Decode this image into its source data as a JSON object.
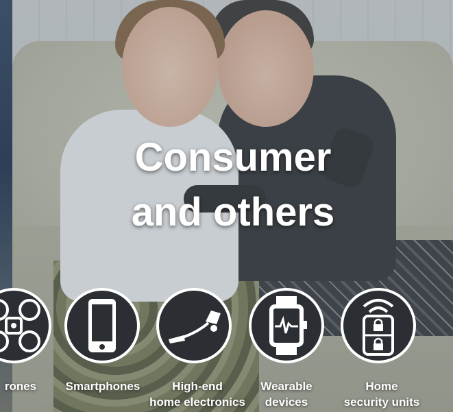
{
  "headline": {
    "line1": "Consumer",
    "line2": "and others"
  },
  "categories": [
    {
      "icon": "drone-icon",
      "label_lines": [
        "rones"
      ]
    },
    {
      "icon": "smartphone-icon",
      "label_lines": [
        "Smartphones"
      ]
    },
    {
      "icon": "vacuum-cleaner-icon",
      "label_lines": [
        "High-end",
        "home electronics"
      ]
    },
    {
      "icon": "smartwatch-icon",
      "label_lines": [
        "Wearable",
        "devices"
      ]
    },
    {
      "icon": "smart-lock-icon",
      "label_lines": [
        "Home",
        "security units"
      ]
    }
  ],
  "colors": {
    "icon_bg": "#2b2f33",
    "icon_stroke": "#ffffff",
    "text": "#ffffff"
  }
}
